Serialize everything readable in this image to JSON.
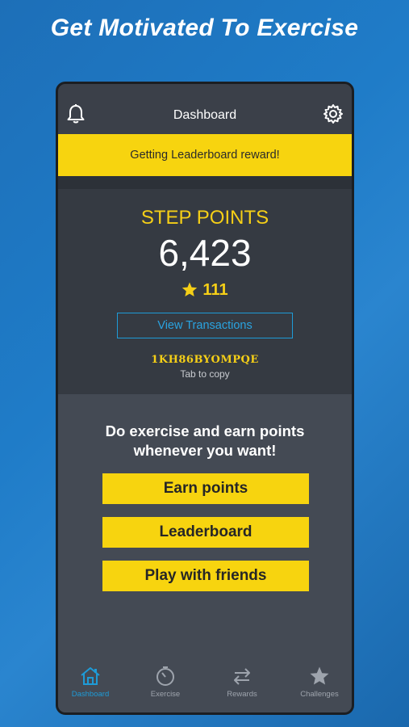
{
  "headline": "Get Motivated To Exercise",
  "header": {
    "title": "Dashboard",
    "left_icon": "bell-icon",
    "right_icon": "gear-icon"
  },
  "banner": {
    "text": "Getting Leaderboard reward!"
  },
  "points": {
    "label": "STEP POINTS",
    "value": "6,423",
    "stars": "111",
    "view_transactions": "View Transactions",
    "code": "1KH86BYOMPQE",
    "copy_hint": "Tab to copy"
  },
  "promo": {
    "text": "Do exercise and earn points whenever you want!",
    "buttons": [
      "Earn points",
      "Leaderboard",
      "Play with friends"
    ]
  },
  "tabs": [
    {
      "label": "Dashboard",
      "icon": "home-icon",
      "active": true
    },
    {
      "label": "Exercise",
      "icon": "stopwatch-icon",
      "active": false
    },
    {
      "label": "Rewards",
      "icon": "swap-arrows-icon",
      "active": false
    },
    {
      "label": "Challenges",
      "icon": "star-icon",
      "active": false
    }
  ],
  "colors": {
    "background": "#1f7cc8",
    "accent_yellow": "#f7d40f",
    "accent_blue": "#1e9bd7",
    "panel": "#353a42"
  }
}
